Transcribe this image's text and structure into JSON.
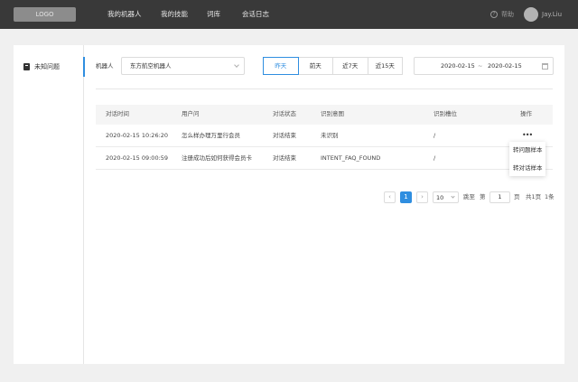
{
  "header": {
    "logo": "LOGO",
    "nav": [
      "我的机器人",
      "我的技能",
      "词库",
      "会话日志"
    ],
    "help_icon": "question-circle-icon",
    "help_label": "帮助",
    "user_name": "Jay.Liu"
  },
  "sidebar": {
    "items": [
      {
        "label": "未知问题",
        "icon": "book-icon",
        "active": true
      }
    ]
  },
  "filters": {
    "robot_label": "机器人",
    "robot_value": "东方航空机器人",
    "date_buttons": [
      "昨天",
      "前天",
      "近7天",
      "近15天"
    ],
    "active_date_button": "昨天",
    "range_start": "2020-02-15",
    "range_separator": "~",
    "range_end": "2020-02-15",
    "calendar_icon": "calendar-icon"
  },
  "table": {
    "columns": [
      "对话时间",
      "用户问",
      "对话状态",
      "识别意图",
      "识别槽位",
      "操作"
    ],
    "rows": [
      {
        "time": "2020-02-15  10:26:20",
        "question": "怎么样办理万里行会员",
        "status": "对话结束",
        "intent": "未识别",
        "slot": "/"
      },
      {
        "time": "2020-02-15  09:00:59",
        "question": "注册成功后如何获得会员卡",
        "status": "对话结束",
        "intent": "INTENT_FAQ_FOUND",
        "slot": "/"
      }
    ],
    "more_icon": "more-dots-icon",
    "action_menu": [
      "转问题样本",
      "转对话样本"
    ]
  },
  "pagination": {
    "prev": "‹",
    "current_page": "1",
    "next": "›",
    "page_size": "10",
    "jump_label": "跳至",
    "page_prefix": "第",
    "page_input": "1",
    "page_suffix": "页",
    "total_pages": "共1页",
    "total_items": "1条"
  },
  "colors": {
    "accent": "#2f8ee0",
    "topbar": "#393939"
  }
}
